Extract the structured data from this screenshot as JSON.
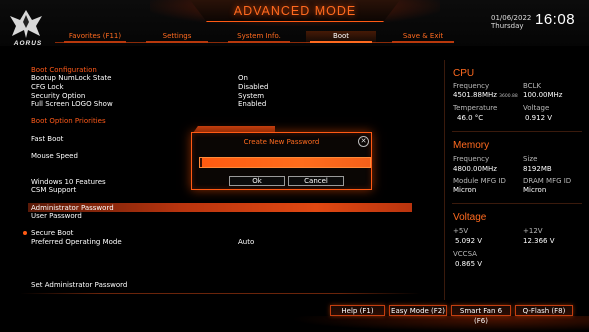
{
  "header": {
    "mode_title": "ADVANCED MODE",
    "logo_text": "AORUS",
    "date": "01/06/2022",
    "weekday": "Thursday",
    "time": "16:08"
  },
  "tabs": [
    {
      "label": "Favorites (F11)",
      "active": false
    },
    {
      "label": "Settings",
      "active": false
    },
    {
      "label": "System Info.",
      "active": false
    },
    {
      "label": "Boot",
      "active": true
    },
    {
      "label": "Save & Exit",
      "active": false
    }
  ],
  "main": {
    "boot_configuration_title": "Boot Configuration",
    "settings": [
      {
        "label": "Bootup NumLock State",
        "value": "On"
      },
      {
        "label": "CFG Lock",
        "value": "Disabled"
      },
      {
        "label": "Security Option",
        "value": "System"
      },
      {
        "label": "Full Screen LOGO Show",
        "value": "Enabled"
      }
    ],
    "boot_option_priorities_title": "Boot Option Priorities",
    "fast_boot": "Fast Boot",
    "mouse_speed": "Mouse Speed",
    "windows_10_features": "Windows 10 Features",
    "csm_support": "CSM Support",
    "administrator_password": "Administrator Password",
    "user_password": "User Password",
    "secure_boot": "Secure Boot",
    "preferred_operating_mode": "Preferred Operating Mode",
    "preferred_operating_mode_value": "Auto",
    "help_text": "Set Administrator Password"
  },
  "dialog": {
    "title": "Create New Password",
    "close_glyph": "✕",
    "password_value": "",
    "ok_label": "Ok",
    "cancel_label": "Cancel"
  },
  "sidebar": {
    "cpu": {
      "title": "CPU",
      "frequency_label": "Frequency",
      "frequency_value": "4501.88MHz",
      "frequency_small": "3600.88",
      "bclk_label": "BCLK",
      "bclk_value": "100.00MHz",
      "temperature_label": "Temperature",
      "temperature_value": "46.0 °C",
      "voltage_label": "Voltage",
      "voltage_value": "0.912 V"
    },
    "memory": {
      "title": "Memory",
      "frequency_label": "Frequency",
      "frequency_value": "4800.00MHz",
      "size_label": "Size",
      "size_value": "8192MB",
      "module_mfg_label": "Module MFG ID",
      "module_mfg_value": "Micron",
      "dram_mfg_label": "DRAM MFG ID",
      "dram_mfg_value": "Micron"
    },
    "voltage": {
      "title": "Voltage",
      "p5v_label": "+5V",
      "p5v_value": "5.092 V",
      "p12v_label": "+12V",
      "p12v_value": "12.366 V",
      "vccsa_label": "VCCSA",
      "vccsa_value": "0.865 V"
    }
  },
  "footer": {
    "buttons": [
      {
        "label": "Help (F1)"
      },
      {
        "label": "Easy Mode (F2)"
      },
      {
        "label": "Smart Fan 6 (F6)"
      },
      {
        "label": "Q-Flash (F8)"
      }
    ]
  },
  "colors": {
    "accent": "#ff6a1f",
    "highlight": "#e04812",
    "background": "#000000"
  }
}
